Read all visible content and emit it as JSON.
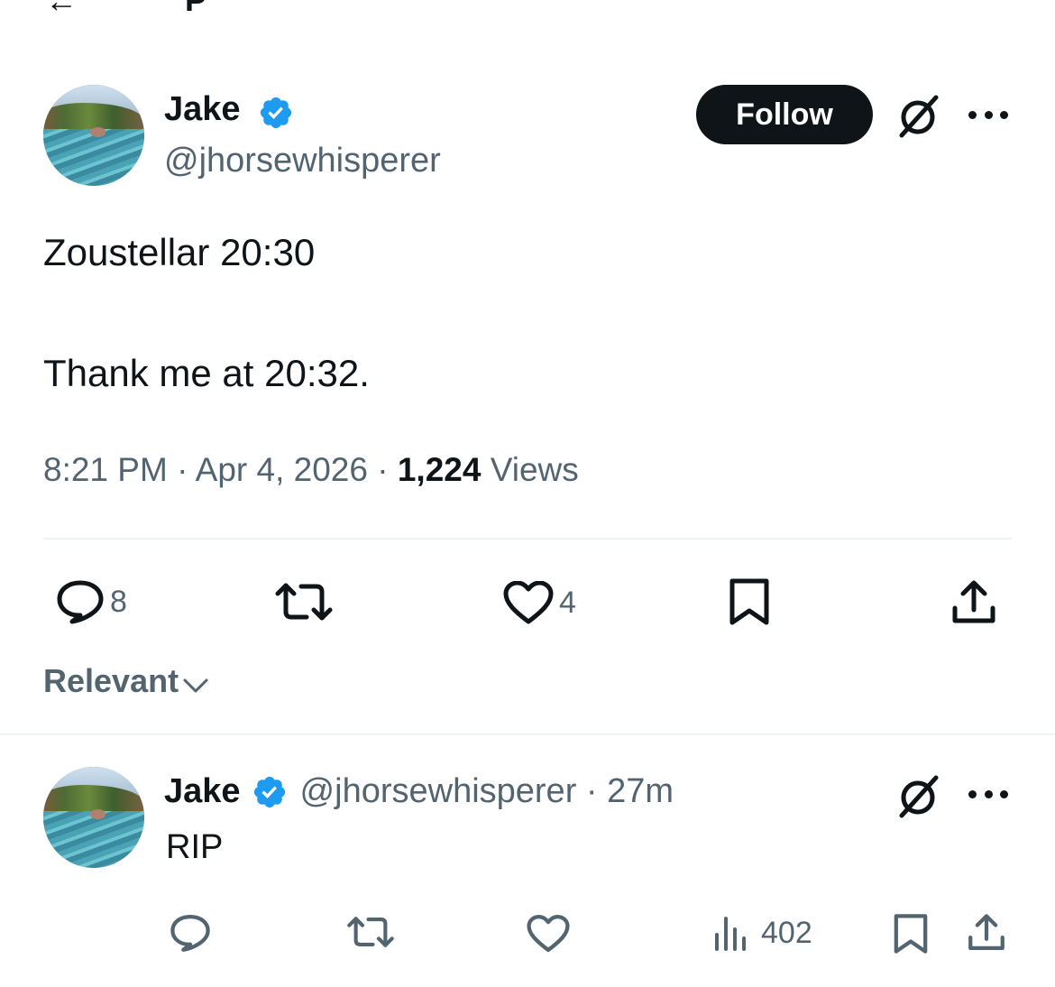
{
  "main_tweet": {
    "author_name": "Jake",
    "author_handle": "@jhorsewhisperer",
    "follow_label": "Follow",
    "text_line1": "Zoustellar 20:30",
    "text_line2": "Thank me at 20:32.",
    "time": "8:21 PM",
    "separator": "·",
    "date": "Apr 4, 2026",
    "views_count": "1,224",
    "views_label": "Views",
    "actions": {
      "replies": "8",
      "likes": "4"
    }
  },
  "sort": {
    "label": "Relevant"
  },
  "reply": {
    "author_name": "Jake",
    "author_handle": "@jhorsewhisperer · 27m",
    "text": "RIP",
    "actions": {
      "views": "402"
    }
  },
  "colors": {
    "verified": "#1d9bf0",
    "text": "#0f1419",
    "secondary": "#536471",
    "divider": "#eff3f4"
  },
  "icons": [
    "verified-badge-icon",
    "grok-icon",
    "more-icon",
    "reply-icon",
    "retweet-icon",
    "like-icon",
    "bookmark-icon",
    "share-icon",
    "views-icon",
    "chevron-down-icon"
  ]
}
